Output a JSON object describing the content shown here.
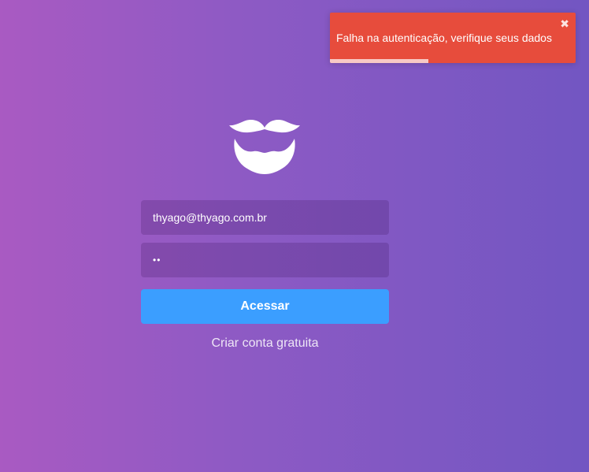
{
  "logo": {
    "icon": "mustache-beard-icon"
  },
  "login": {
    "email_value": "thyago@thyago.com.br",
    "password_value": "12",
    "submit_label": "Acessar",
    "signup_link": "Criar conta gratuita"
  },
  "toast": {
    "message": "Falha na autenticação, verifique seus dados",
    "close_icon": "✖",
    "progress": 0.4,
    "color": "#e74c3c"
  },
  "colors": {
    "accent": "#3b9eff",
    "background_start": "#a95ac2",
    "background_end": "#7256c2"
  }
}
